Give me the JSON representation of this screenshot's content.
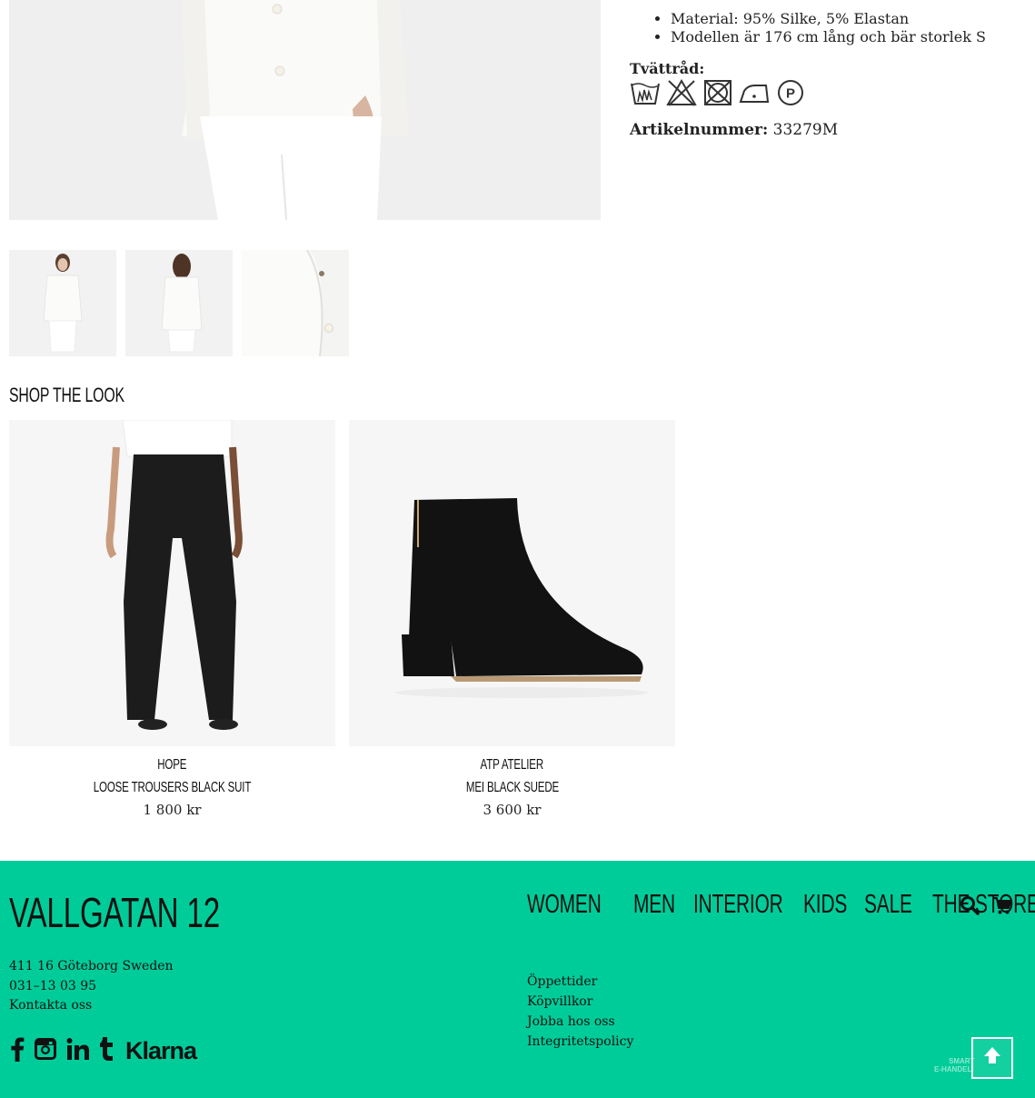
{
  "details": {
    "bullets": [
      "Material: 95% Silke, 5% Elastan",
      "Modellen är 176 cm lång och bär storlek S"
    ],
    "wash_label": "Tvättråd:",
    "wash_icons": [
      "handwash-icon",
      "no-bleach-icon",
      "no-tumble-dry-icon",
      "iron-low-icon",
      "dry-clean-p-icon"
    ],
    "article_label": "Artikelnummer:",
    "article_number": "33279M"
  },
  "thumbnails": [
    "front-view",
    "back-view",
    "detail-view"
  ],
  "shop_the_look": {
    "title": "SHOP THE LOOK",
    "products": [
      {
        "brand": "HOPE",
        "name": "LOOSE TROUSERS BLACK SUIT",
        "price": "1 800 kr"
      },
      {
        "brand": "ATP ATELIER",
        "name": "MEI BLACK SUEDE",
        "price": "3 600 kr"
      }
    ]
  },
  "footer": {
    "logo": "VALLGATAN 12",
    "address": [
      "411 16 Göteborg Sweden",
      "031–13 03 95",
      "Kontakta oss"
    ],
    "social": [
      "facebook-icon",
      "instagram-icon",
      "linkedin-icon",
      "tumblr-icon"
    ],
    "klarna": "Klarna",
    "nav": [
      "WOMEN",
      "MEN",
      "INTERIOR",
      "KIDS",
      "SALE",
      "THE STORE"
    ],
    "links": [
      "Öppettider",
      "Köpvillkor",
      "Jobba hos oss",
      "Integritetspolicy"
    ],
    "smart_badge": [
      "SMART",
      "E-HANDEL"
    ],
    "accent_color": "#00cc99"
  }
}
